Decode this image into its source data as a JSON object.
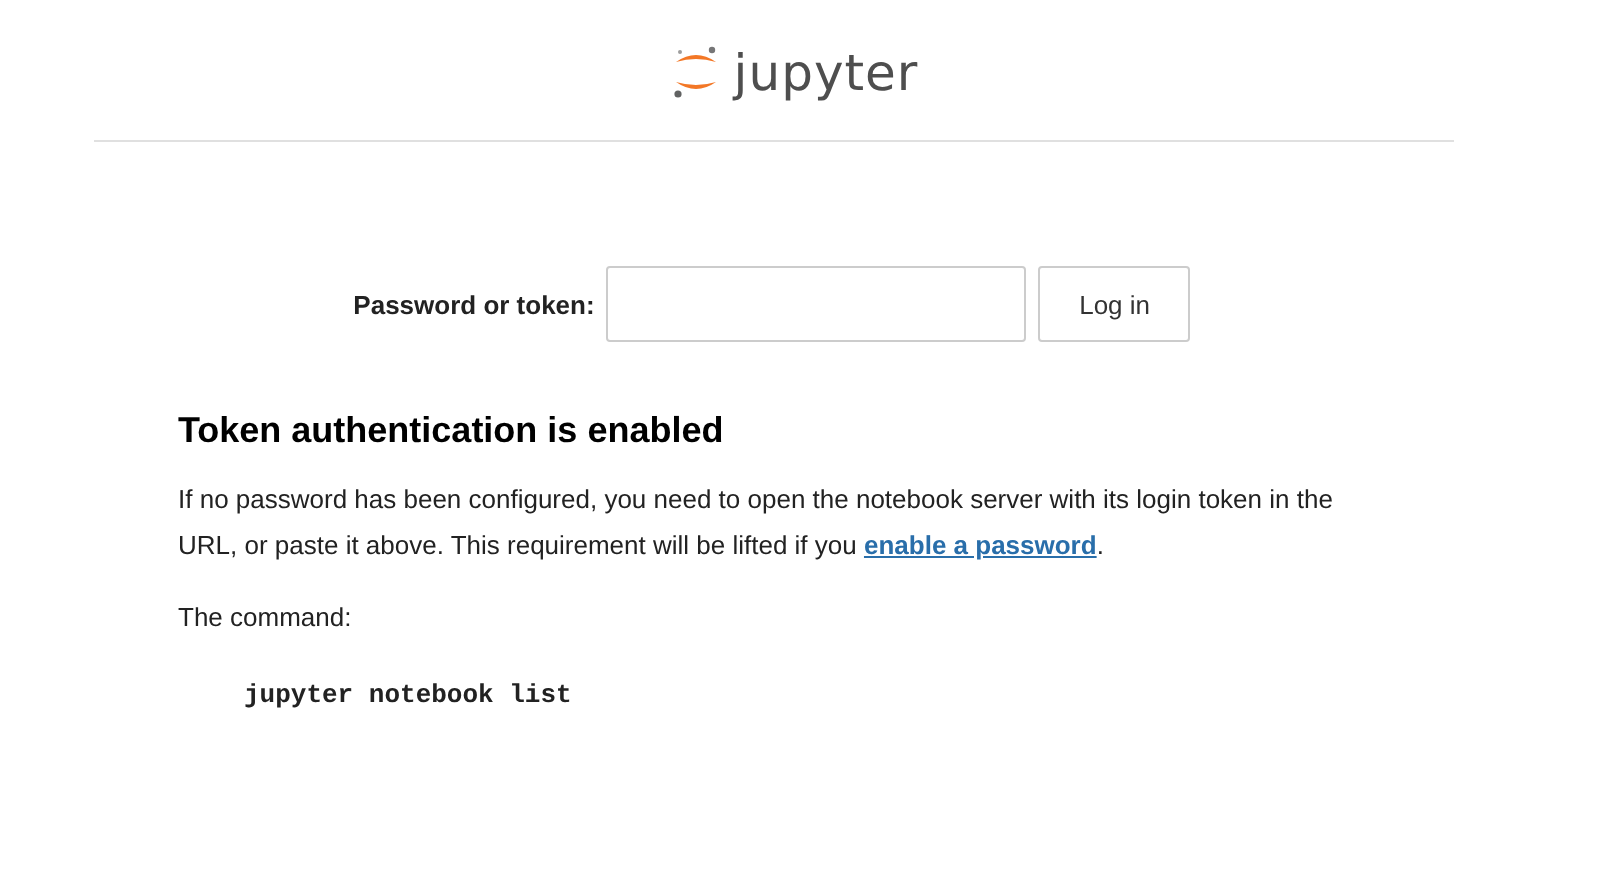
{
  "header": {
    "logo_text": "jupyter"
  },
  "login_form": {
    "label": "Password or token:",
    "button": "Log in"
  },
  "info": {
    "heading": "Token authentication is enabled",
    "paragraph": {
      "text_before": "If no password has been configured, you need to open the notebook server with its login token in the URL, or paste it above. This requirement will be lifted if you ",
      "link": "enable a password",
      "text_after": "."
    },
    "command_label": "The command:",
    "command": "jupyter notebook list"
  }
}
